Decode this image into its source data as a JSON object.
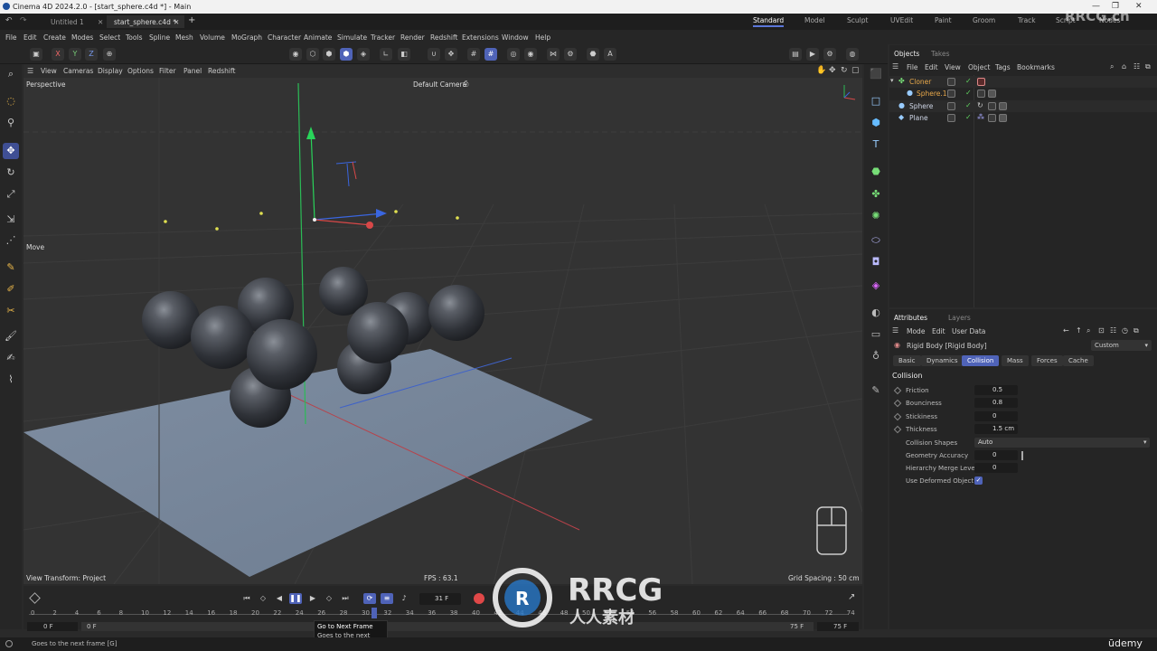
{
  "window": {
    "title": "Cinema 4D 2024.2.0 - [start_sphere.c4d *] - Main",
    "controls": [
      "—",
      "❐",
      "✕"
    ]
  },
  "doc_tabs": [
    {
      "label": "Untitled 1",
      "close": "✕"
    },
    {
      "label": "start_sphere.c4d *",
      "close": "✕"
    }
  ],
  "add_tab": "+",
  "layouts": [
    "Standard",
    "Model",
    "Sculpt",
    "UVEdit",
    "Paint",
    "Groom",
    "Track",
    "Script",
    "Nodes"
  ],
  "menu": [
    "File",
    "Edit",
    "Create",
    "Modes",
    "Select",
    "Tools",
    "Spline",
    "Mesh",
    "Volume",
    "MoGraph",
    "Character",
    "Animate",
    "Simulate",
    "Tracker",
    "Render",
    "Redshift",
    "Extensions",
    "Window",
    "Help"
  ],
  "axis_lock": [
    "X",
    "Y",
    "Z"
  ],
  "viewport_menu": [
    "View",
    "Cameras",
    "Display",
    "Options",
    "Filter",
    "Panel",
    "Redshift"
  ],
  "viewport": {
    "name": "Perspective",
    "camera": "Default Camera",
    "tool": "Move",
    "view_transform": "View Transform: Project",
    "fps": "FPS : 63.1",
    "grid": "Grid Spacing : 50 cm"
  },
  "objects_tabs": [
    "Objects",
    "Takes"
  ],
  "objects_menu": [
    "File",
    "Edit",
    "View",
    "Object",
    "Tags",
    "Bookmarks"
  ],
  "objects": [
    {
      "name": "Cloner",
      "color": "#e8a84a"
    },
    {
      "name": "Sphere.1",
      "color": "#e8a84a"
    },
    {
      "name": "Sphere",
      "color": "#cfd6e6"
    },
    {
      "name": "Plane",
      "color": "#cfd6e6"
    }
  ],
  "attr_tabs": [
    "Attributes",
    "Layers"
  ],
  "attr_menu": [
    "Mode",
    "Edit",
    "User Data"
  ],
  "attr_object": "Rigid Body [Rigid Body]",
  "attr_preset": "Custom",
  "attr_subtabs": [
    "Basic",
    "Dynamics",
    "Collision",
    "Mass",
    "Forces",
    "Cache"
  ],
  "attr_section": "Collision",
  "attr_fields": [
    {
      "label": "Friction",
      "value": "0.5"
    },
    {
      "label": "Bounciness",
      "value": "0.8"
    },
    {
      "label": "Stickiness",
      "value": "0"
    },
    {
      "label": "Thickness",
      "value": "1.5 cm"
    }
  ],
  "attr_fields2": [
    {
      "label": "Collision Shapes",
      "value": "Auto"
    },
    {
      "label": "Geometry Accuracy",
      "value": "0"
    },
    {
      "label": "Hierarchy Merge Level",
      "value": "0"
    },
    {
      "label": "Use Deformed Object",
      "value": "✓"
    }
  ],
  "timeline": {
    "ticks": [
      "0",
      "2",
      "4",
      "6",
      "8",
      "10",
      "12",
      "14",
      "16",
      "18",
      "20",
      "22",
      "24",
      "26",
      "28",
      "30",
      "32",
      "34",
      "36",
      "38",
      "40",
      "42",
      "44",
      "46",
      "48",
      "50",
      "52",
      "54",
      "56",
      "58",
      "60",
      "62",
      "64",
      "66",
      "68",
      "70",
      "72",
      "74"
    ],
    "frame": "31 F",
    "start": "0 F",
    "start2": "0 F",
    "end": "75 F",
    "end2": "75 F"
  },
  "tooltip": {
    "title": "Go to Next Frame",
    "desc": "Goes to the next frame",
    "key": "[G]"
  },
  "status": "Goes to the next frame [G]",
  "watermark": {
    "big": "RRCG",
    "small": "人人素材",
    "corner": "RRCG.cn",
    "udemy": "ūdemy"
  }
}
